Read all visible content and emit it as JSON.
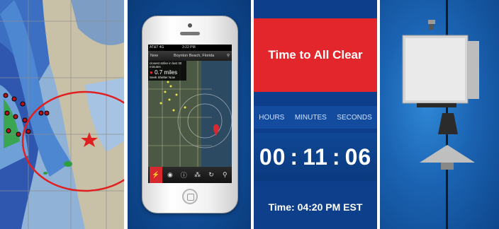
{
  "panels": {
    "map": {
      "description_icon": "storm-radar-map"
    },
    "phone": {
      "carrier": "AT&T 4G",
      "time": "3:22 PM",
      "nav_back": "Now",
      "location": "Boynton Beach, Florida",
      "strike_caption": "closest strike in last 30 minutes",
      "distance": "0.7 miles",
      "advice": "Seek Shelter Now",
      "toolbar_icons": [
        "lightning-icon",
        "radar-icon",
        "info-icon",
        "share-icon",
        "refresh-icon",
        "search-icon"
      ],
      "map_places": [
        "Royal Palm Beach",
        "West Palm Beach",
        "Palm Beach",
        "Lake Worth",
        "Boynton Beach",
        "Riviera Beach"
      ]
    },
    "timer": {
      "title": "Time to All Clear",
      "col_hours": "HOURS",
      "col_minutes": "MINUTES",
      "col_seconds": "SECONDS",
      "hours": "00",
      "minutes": "11",
      "seconds": "06",
      "clock": "Time: 04:20 PM EST"
    },
    "siren": {
      "description_icon": "outdoor-warning-siren"
    }
  },
  "colors": {
    "accent_red": "#e2262b",
    "timer_blue": "#0c3e8c",
    "siren_blue": "#1b64b3"
  }
}
